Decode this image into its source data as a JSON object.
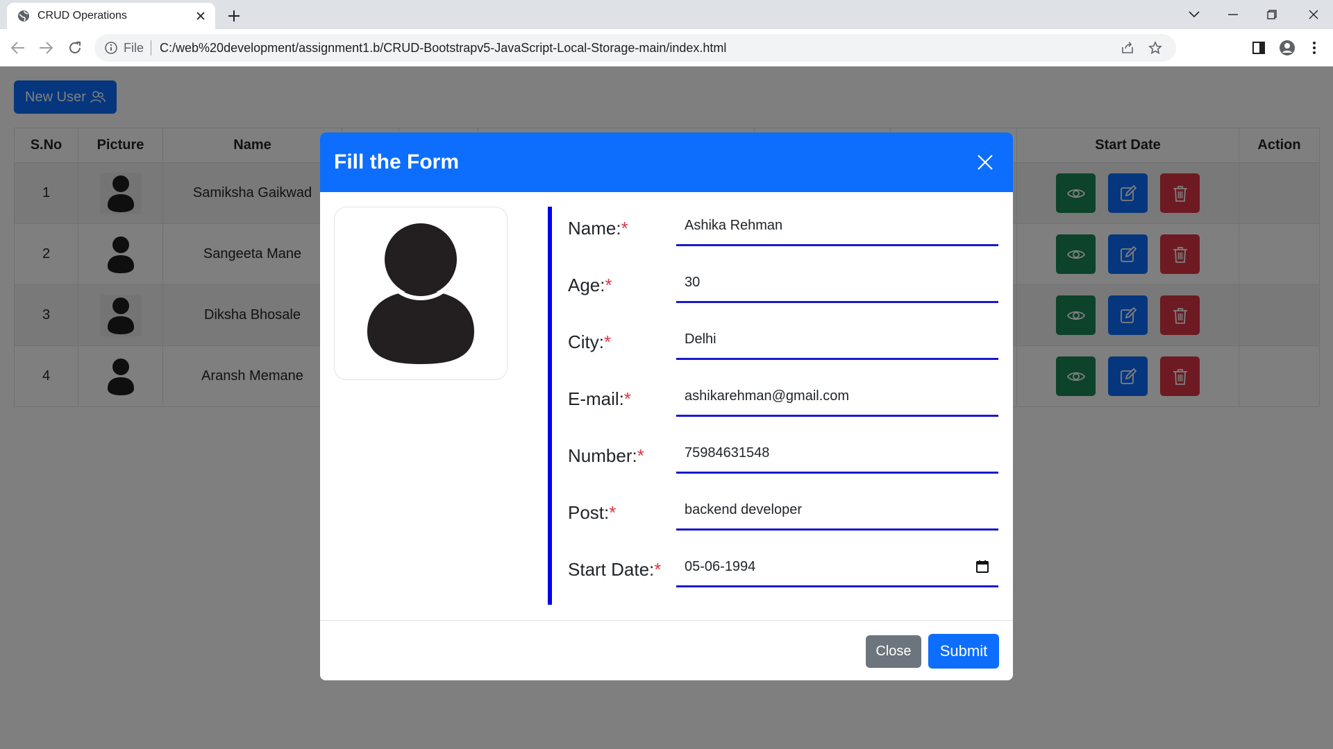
{
  "browser": {
    "tab_title": "CRUD Operations",
    "scheme_label": "File",
    "url": "C:/web%20development/assignment1.b/CRUD-Bootstrapv5-JavaScript-Local-Storage-main/index.html"
  },
  "page": {
    "new_user_label": "New User",
    "table": {
      "headers": [
        "S.No",
        "Picture",
        "Name",
        "Start Date",
        "Action"
      ],
      "rows": [
        {
          "sno": "1",
          "name": "Samiksha Gaikwad"
        },
        {
          "sno": "2",
          "name": "Sangeeta Mane"
        },
        {
          "sno": "3",
          "name": "Diksha Bhosale"
        },
        {
          "sno": "4",
          "name": "Aransh Memane"
        }
      ]
    }
  },
  "modal": {
    "title": "Fill the Form",
    "fields": [
      {
        "label": "Name:",
        "value": "Ashika Rehman"
      },
      {
        "label": "Age:",
        "value": "30"
      },
      {
        "label": "City:",
        "value": "Delhi"
      },
      {
        "label": "E-mail:",
        "value": "ashikarehman@gmail.com"
      },
      {
        "label": "Number:",
        "value": "75984631548"
      },
      {
        "label": "Post:",
        "value": "backend developer"
      },
      {
        "label": "Start Date:",
        "value": "05-06-1994"
      }
    ],
    "required_mark": "*",
    "close_label": "Close",
    "submit_label": "Submit"
  },
  "colors": {
    "primary": "#0d6efd",
    "success": "#198754",
    "danger": "#dc3545",
    "secondary": "#6c757d",
    "accent_bar": "#0000ee"
  },
  "icons": [
    "globe-icon",
    "close-icon",
    "plus-icon",
    "back-icon",
    "forward-icon",
    "reload-icon",
    "info-icon",
    "share-icon",
    "star-icon",
    "sidepanel-icon",
    "profile-icon",
    "menu-icon",
    "users-icon",
    "eye-icon",
    "edit-icon",
    "trash-icon",
    "avatar-icon",
    "calendar-icon"
  ]
}
